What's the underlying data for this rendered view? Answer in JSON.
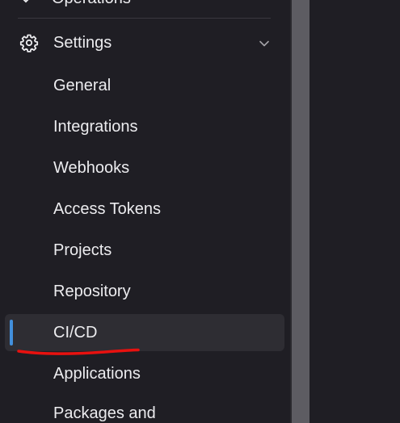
{
  "sidebar": {
    "top_item": {
      "label": "Operations",
      "icon": "rocket-icon"
    },
    "section": {
      "label": "Settings",
      "icon": "gear-icon",
      "expand_icon": "chevron-down-icon"
    },
    "items": [
      {
        "label": "General"
      },
      {
        "label": "Integrations"
      },
      {
        "label": "Webhooks"
      },
      {
        "label": "Access Tokens"
      },
      {
        "label": "Projects"
      },
      {
        "label": "Repository"
      },
      {
        "label": "CI/CD",
        "active": true
      },
      {
        "label": "Applications"
      },
      {
        "label": "Packages and"
      }
    ]
  },
  "colors": {
    "background": "#1f1e24",
    "text": "#ececef",
    "active_bg": "#2e2d33",
    "active_indicator": "#428fdc",
    "annotation": "#e8110f",
    "scrollbar": "#5d5c62"
  }
}
